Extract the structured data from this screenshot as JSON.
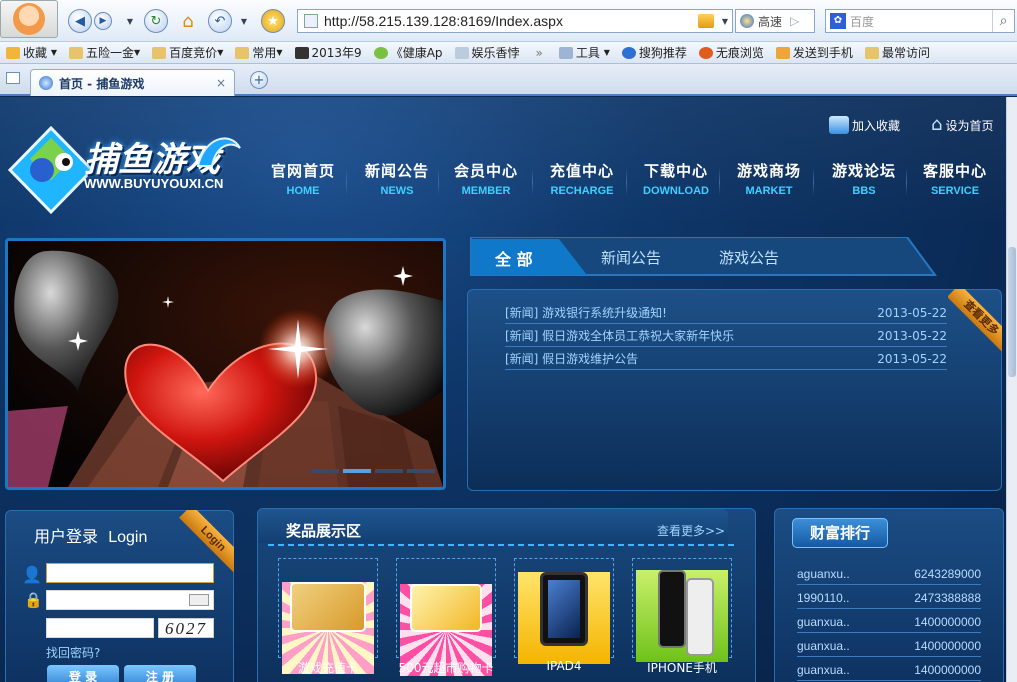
{
  "browser": {
    "url": "http://58.215.139.128:8169/Index.aspx",
    "speed_label": "高速",
    "search_placeholder": "百度",
    "favorites": [
      {
        "label": "收藏"
      },
      {
        "label": "五险一金"
      },
      {
        "label": "百度竞价"
      },
      {
        "label": "常用"
      },
      {
        "label": "2013年9"
      },
      {
        "label": "《健康Ap"
      },
      {
        "label": "娱乐香悖"
      },
      {
        "label": "工具"
      },
      {
        "label": "搜狗推荐"
      },
      {
        "label": "无痕浏览"
      },
      {
        "label": "发送到手机"
      },
      {
        "label": "最常访问"
      }
    ],
    "tab_title": "首页 - 捕鱼游戏",
    "tab_close": "×",
    "more_glyph": "»"
  },
  "site": {
    "logo_text": "捕鱼游戏",
    "logo_domain": "WWW.BUYUYOUXI.CN",
    "add_favorite": "加入收藏",
    "set_home": "设为首页",
    "nav": [
      {
        "cn": "官网首页",
        "en": "HOME"
      },
      {
        "cn": "新闻公告",
        "en": "NEWS"
      },
      {
        "cn": "会员中心",
        "en": "MEMBER"
      },
      {
        "cn": "充值中心",
        "en": "RECHARGE"
      },
      {
        "cn": "下载中心",
        "en": "DOWNLOAD"
      },
      {
        "cn": "游戏商场",
        "en": "MARKET"
      },
      {
        "cn": "游戏论坛",
        "en": "BBS"
      },
      {
        "cn": "客服中心",
        "en": "SERVICE"
      }
    ]
  },
  "news": {
    "tabs": [
      "全 部",
      "新闻公告",
      "游戏公告"
    ],
    "more_ribbon": "查看更多",
    "items": [
      {
        "title": "[新闻] 游戏银行系统升级通知!",
        "date": "2013-05-22"
      },
      {
        "title": "[新闻] 假日游戏全体员工恭祝大家新年快乐",
        "date": "2013-05-22"
      },
      {
        "title": "[新闻] 假日游戏维护公告",
        "date": "2013-05-22"
      }
    ]
  },
  "login": {
    "title": "用户登录",
    "title_en": "Login",
    "ribbon": "Login",
    "captcha": "6027",
    "forgot": "找回密码?",
    "login_btn": "登 录",
    "register_btn": "注 册"
  },
  "prizes": {
    "title": "奖品展示区",
    "more": "查看更多>>",
    "items": [
      {
        "label": "游戏充值卡"
      },
      {
        "label": "500元超市购物卡"
      },
      {
        "label": "IPAD4"
      },
      {
        "label": "IPHONE手机"
      }
    ]
  },
  "rank": {
    "title": "财富排行",
    "rows": [
      {
        "name": "aguanxu..",
        "value": "6243289000"
      },
      {
        "name": "1990110..",
        "value": "2473388888"
      },
      {
        "name": "guanxua..",
        "value": "1400000000"
      },
      {
        "name": "guanxua..",
        "value": "1400000000"
      },
      {
        "name": "guanxua..",
        "value": "1400000000"
      }
    ]
  }
}
